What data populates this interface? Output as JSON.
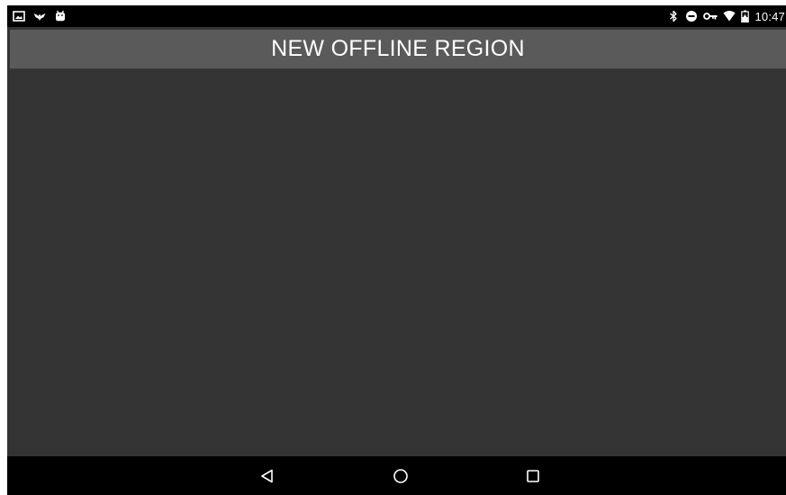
{
  "status_bar": {
    "left_icons": [
      "image-notification-icon",
      "bird-notification-icon",
      "android-notification-icon"
    ],
    "right_icons": [
      "bluetooth-icon",
      "do-not-disturb-icon",
      "vpn-key-icon",
      "wifi-icon",
      "battery-charging-icon"
    ],
    "time": "10:47"
  },
  "app": {
    "title": "NEW OFFLINE REGION",
    "colors": {
      "title_bar": "#5a5a5a",
      "content_background": "#333333",
      "system_bars": "#000000"
    }
  },
  "nav_bar": {
    "buttons": [
      "back-icon",
      "home-icon",
      "recents-icon"
    ]
  }
}
